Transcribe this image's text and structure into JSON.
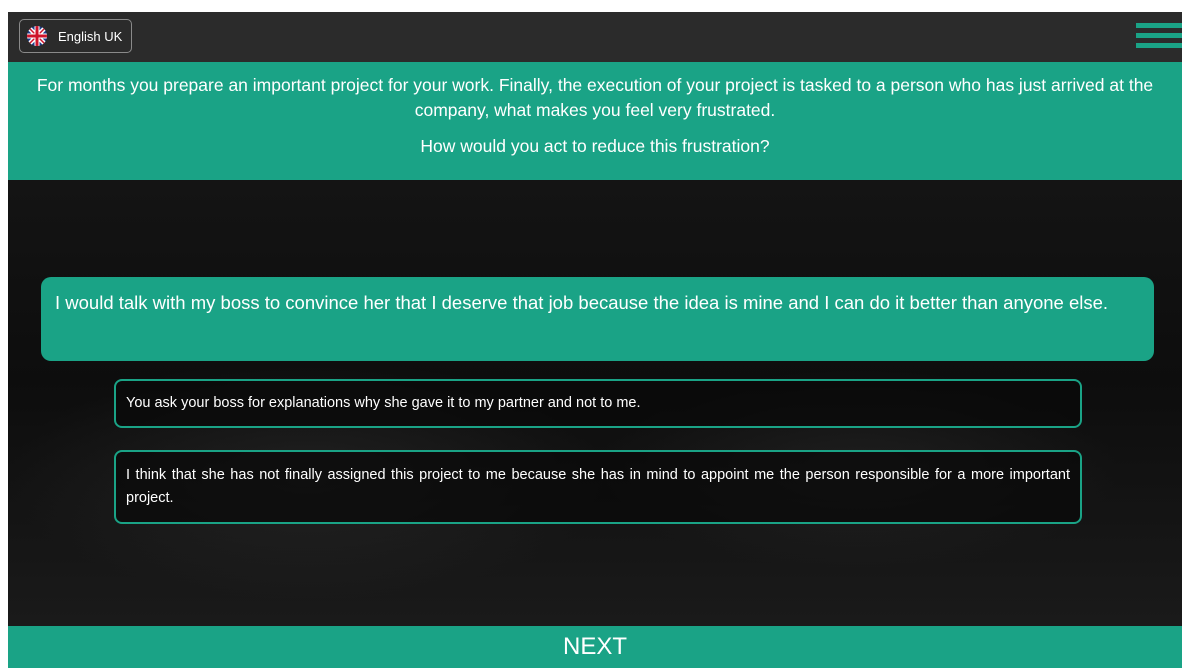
{
  "header": {
    "language_label": "English UK",
    "language_flag_icon": "uk-flag-icon",
    "menu_icon": "hamburger-menu-icon"
  },
  "question": {
    "scenario": "For months you prepare an important project for your work. Finally, the execution of your project is tasked to a person who has just arrived at the company, what makes you feel very frustrated.",
    "prompt": "How would you act to reduce this frustration?"
  },
  "options": [
    {
      "text": "I would talk with my boss to convince her that I deserve that job because the idea is mine and I can do it better than anyone else.",
      "selected": true
    },
    {
      "text": "You ask your boss for explanations why she gave it to my partner and not to me.",
      "selected": false
    },
    {
      "text": "I think that she has not finally assigned this project to me because she has in mind to appoint me the person responsible for a more important project.",
      "selected": false
    }
  ],
  "footer": {
    "next_label": "NEXT"
  },
  "colors": {
    "accent": "#1aa386",
    "topbar": "#2b2b2b",
    "background": "#101010"
  }
}
